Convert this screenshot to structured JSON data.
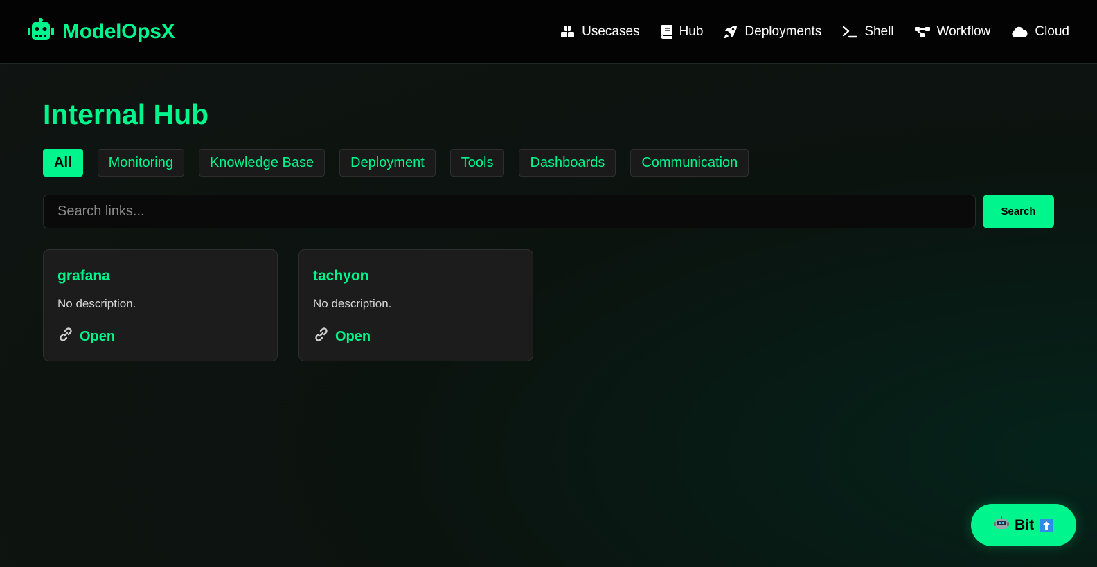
{
  "brand": {
    "name": "ModelOpsX",
    "icon": "robot-icon",
    "accent": "#00f58c"
  },
  "nav": {
    "items": [
      {
        "label": "Usecases",
        "icon": "cubes-icon"
      },
      {
        "label": "Hub",
        "icon": "book-icon"
      },
      {
        "label": "Deployments",
        "icon": "rocket-icon"
      },
      {
        "label": "Shell",
        "icon": "terminal-icon"
      },
      {
        "label": "Workflow",
        "icon": "diagram-icon"
      },
      {
        "label": "Cloud",
        "icon": "cloud-icon"
      }
    ]
  },
  "page": {
    "title": "Internal Hub"
  },
  "filters": {
    "active": "All",
    "items": [
      "All",
      "Monitoring",
      "Knowledge Base",
      "Deployment",
      "Tools",
      "Dashboards",
      "Communication"
    ]
  },
  "search": {
    "placeholder": "Search links...",
    "value": "",
    "button_label": "Search"
  },
  "cards": [
    {
      "title": "grafana",
      "description": "No description.",
      "link_label": "Open",
      "link_icon": "link-icon"
    },
    {
      "title": "tachyon",
      "description": "No description.",
      "link_label": "Open",
      "link_icon": "link-icon"
    }
  ],
  "assistant": {
    "label": "Bit",
    "icon": "robot-icon",
    "badge_icon": "arrow-up-icon"
  }
}
